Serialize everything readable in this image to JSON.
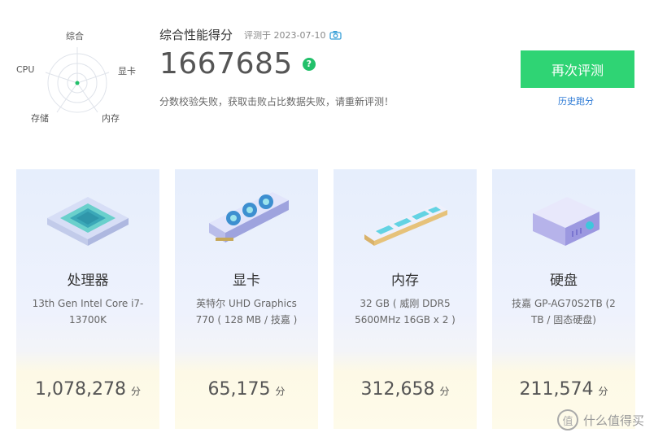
{
  "radar": {
    "labels": {
      "top": "综合",
      "left": "CPU",
      "right": "显卡",
      "bottom_left": "存储",
      "bottom_right": "内存"
    }
  },
  "header": {
    "title": "综合性能得分",
    "eval_date": "评测于 2023-07-10",
    "score": "1667685",
    "help": "?",
    "warning": "分数校验失败，获取击败占比数据失败，请重新评测！",
    "retest_label": "再次评测",
    "history_label": "历史跑分"
  },
  "cards": [
    {
      "title": "处理器",
      "desc": "13th Gen Intel Core i7-13700K",
      "score": "1,078,278",
      "unit": "分",
      "icon": "cpu-chip-icon"
    },
    {
      "title": "显卡",
      "desc": "英特尔 UHD Graphics 770 ( 128 MB / 技嘉 )",
      "score": "65,175",
      "unit": "分",
      "icon": "graphics-card-icon"
    },
    {
      "title": "内存",
      "desc": "32 GB ( 威刚 DDR5 5600MHz 16GB x 2 )",
      "score": "312,658",
      "unit": "分",
      "icon": "memory-stick-icon"
    },
    {
      "title": "硬盘",
      "desc": "技嘉 GP-AG70S2TB (2 TB / 固态硬盘)",
      "score": "211,574",
      "unit": "分",
      "icon": "hard-drive-icon"
    }
  ],
  "watermark": {
    "badge": "值",
    "text": "什么值得买"
  },
  "colors": {
    "accent_green": "#2fd474",
    "link_blue": "#2e7bd6",
    "center_dot": "#22c06a"
  }
}
